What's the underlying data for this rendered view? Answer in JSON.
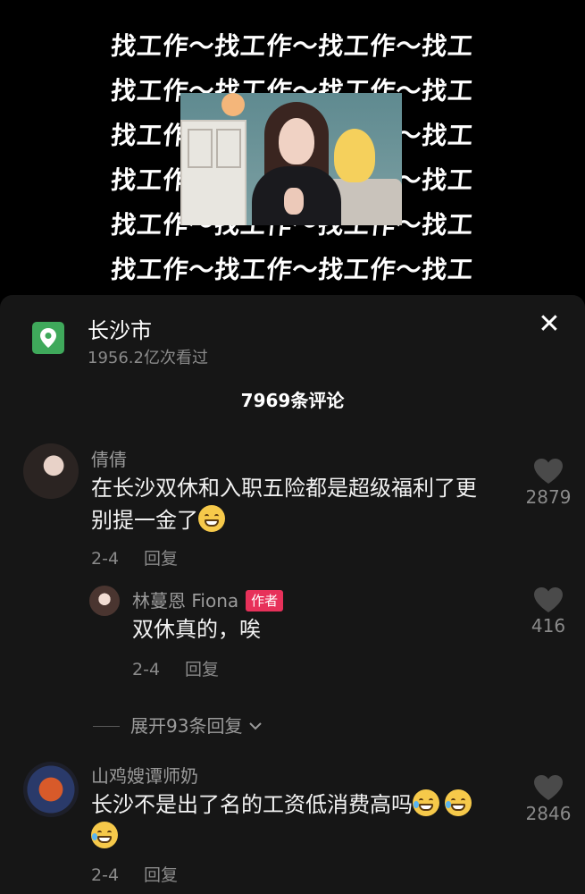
{
  "video": {
    "pattern_lines": [
      "找工作～找工作～找工作～找工",
      "找工作～找工作～找工作～找工",
      "找工作～找工作～找工作～找工",
      "找工作～找工作～找工作～找工",
      "找工作～找工作～找工作～找工",
      "找工作～找工作～找工作～找工"
    ]
  },
  "location": {
    "name": "长沙市",
    "views": "1956.2亿次看过",
    "icon": "map-pin-icon",
    "icon_color": "#3fa95b"
  },
  "comments_title": "7969条评论",
  "comments": [
    {
      "user": "倩倩",
      "text_line1": "在长沙双休和入职五险都是超级福利了更",
      "text_line2": "别提一金了",
      "date": "2-4",
      "reply_label": "回复",
      "likes": "2879"
    },
    {
      "user": "林蔓恩 Fiona",
      "author_tag": "作者",
      "text": "双休真的，唉",
      "date": "2-4",
      "reply_label": "回复",
      "likes": "416"
    },
    {
      "user": "山鸡嫂谭师奶",
      "text": "长沙不是出了名的工资低消费高吗",
      "date": "2-4",
      "reply_label": "回复",
      "likes": "2846"
    }
  ],
  "expand_replies": "展开93条回复",
  "colors": {
    "sheet_bg": "#161616",
    "author_tag_bg": "#e7315a"
  }
}
